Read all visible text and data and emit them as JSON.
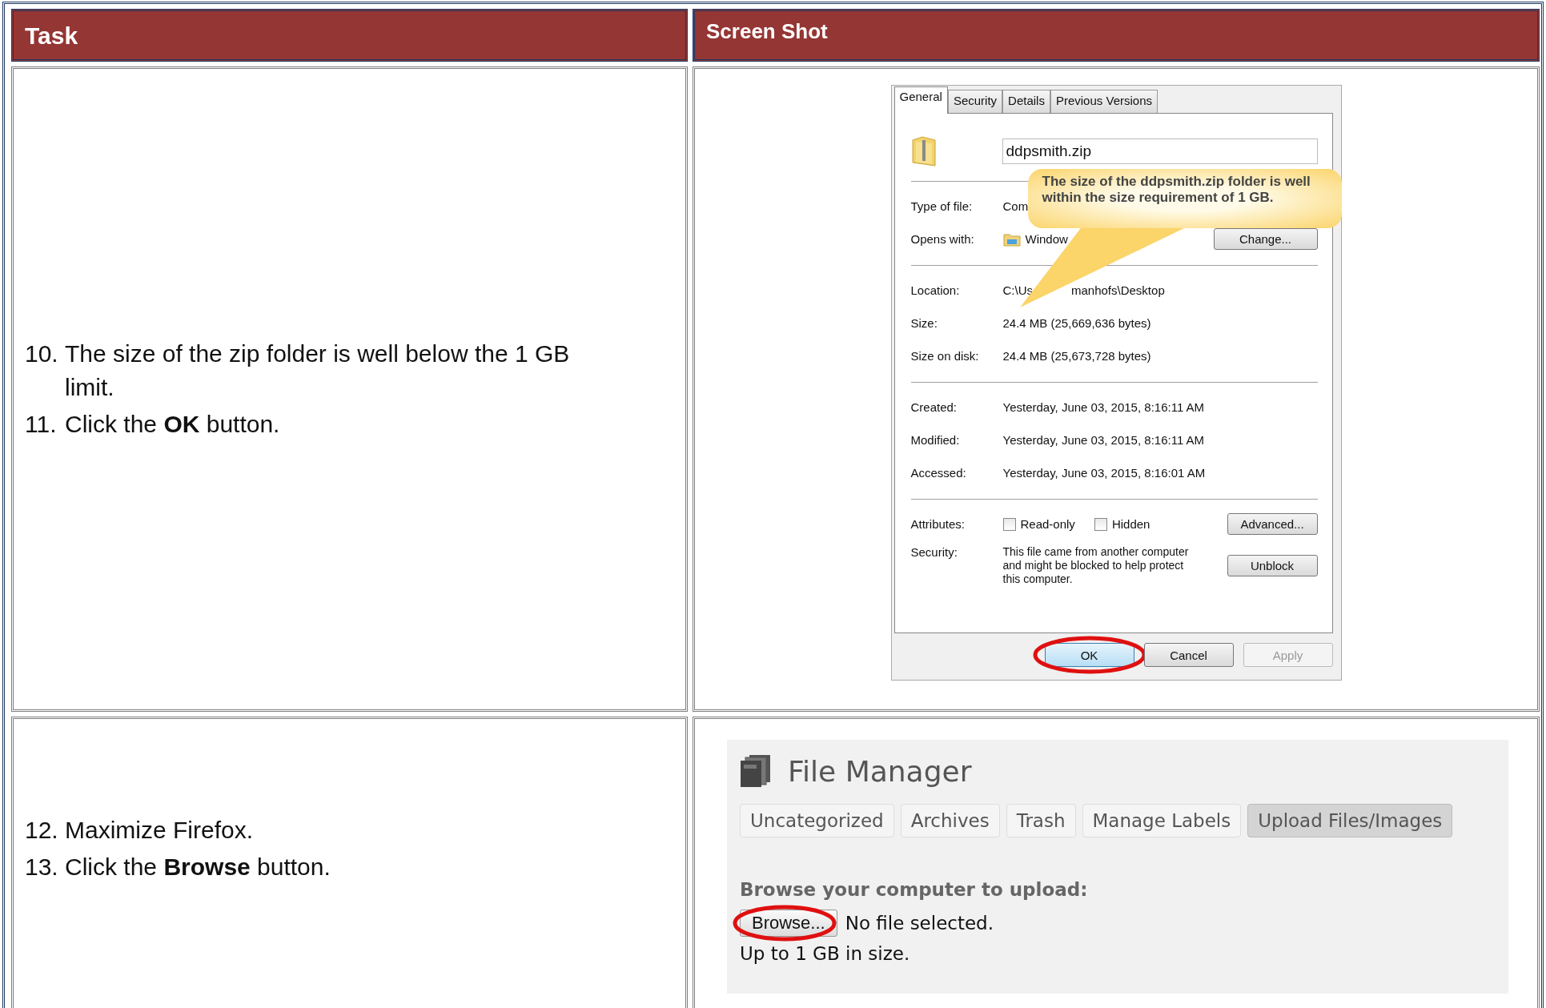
{
  "table": {
    "columns": [
      "Task",
      "Screen Shot"
    ],
    "rows": [
      {
        "steps": [
          {
            "number": "10.",
            "text": "The size of the zip folder is well below the 1 GB limit."
          },
          {
            "number": "11.",
            "text": "Click the **OK** button."
          }
        ],
        "screenshot": {
          "kind": "properties_dialog",
          "tabs": [
            {
              "label": "General",
              "selected": true
            },
            {
              "label": "Security",
              "selected": false
            },
            {
              "label": "Details",
              "selected": false
            },
            {
              "label": "Previous Versions",
              "selected": false
            }
          ],
          "file_name": "ddpsmith.zip",
          "type_of_file": {
            "label": "Type of file:",
            "value": "Com"
          },
          "opens_with": {
            "label": "Opens with:",
            "value": "Window",
            "button": "Change..."
          },
          "location": {
            "label": "Location:",
            "value_start": "C:\\Us",
            "value_end": "manhofs\\Desktop"
          },
          "sizes": [
            {
              "label": "Size:",
              "value": "24.4 MB (25,669,636 bytes)"
            },
            {
              "label": "Size on disk:",
              "value": "24.4 MB (25,673,728 bytes)"
            }
          ],
          "dates": [
            {
              "label": "Created:",
              "value": "Yesterday, June 03, 2015, 8:16:11 AM"
            },
            {
              "label": "Modified:",
              "value": "Yesterday, June 03, 2015, 8:16:11 AM"
            },
            {
              "label": "Accessed:",
              "value": "Yesterday, June 03, 2015, 8:16:01 AM"
            }
          ],
          "attributes": {
            "label": "Attributes:",
            "checkboxes": [
              {
                "label": "Read-only",
                "checked": false
              },
              {
                "label": "Hidden",
                "checked": false
              }
            ],
            "button": "Advanced..."
          },
          "security": {
            "label": "Security:",
            "text": "This file came from another computer and might be blocked to help protect this computer.",
            "button": "Unblock"
          },
          "buttons": [
            {
              "label": "OK",
              "default": true,
              "disabled": false,
              "highlighted": true
            },
            {
              "label": "Cancel",
              "default": false,
              "disabled": false,
              "highlighted": false
            },
            {
              "label": "Apply",
              "default": false,
              "disabled": true,
              "highlighted": false
            }
          ],
          "callout": "The size of the ddpsmith.zip folder is well within the size requirement of 1 GB."
        }
      },
      {
        "steps": [
          {
            "number": "12.",
            "text": "Maximize Firefox."
          },
          {
            "number": "13.",
            "text": "Click the **Browse** button."
          }
        ],
        "screenshot": {
          "kind": "file_manager",
          "title": "File Manager",
          "tabs": [
            {
              "label": "Uncategorized",
              "selected": false
            },
            {
              "label": "Archives",
              "selected": false
            },
            {
              "label": "Trash",
              "selected": false
            },
            {
              "label": "Manage Labels",
              "selected": false
            },
            {
              "label": "Upload Files/Images",
              "selected": true
            }
          ],
          "prompt": "Browse your computer to upload:",
          "browse_button": {
            "label": "Browse...",
            "highlighted": true
          },
          "file_status": "No file selected.",
          "note": "Up to 1 GB in size."
        }
      }
    ]
  }
}
